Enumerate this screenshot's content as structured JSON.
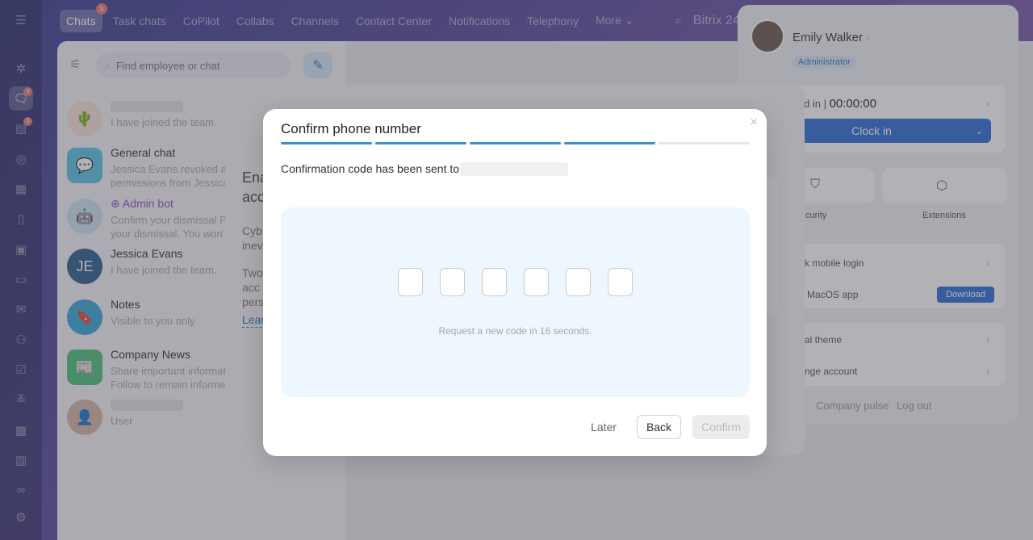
{
  "top_nav": {
    "items": [
      {
        "label": "Chats",
        "badge": "3"
      },
      {
        "label": "Task chats"
      },
      {
        "label": "CoPilot"
      },
      {
        "label": "Collabs"
      },
      {
        "label": "Channels"
      },
      {
        "label": "Contact Center"
      },
      {
        "label": "Notifications"
      },
      {
        "label": "Telephony"
      },
      {
        "label": "More ⌄"
      }
    ],
    "brand": "Bitrix 24"
  },
  "rail": {
    "icons": [
      "menu-icon",
      "copilot-icon",
      "chat-icon",
      "feed-icon",
      "target-icon",
      "calendar-icon",
      "document-icon",
      "tasks-board-icon",
      "drive-icon",
      "mail-icon",
      "contacts-icon",
      "checklist-icon",
      "filter-icon",
      "booking-icon",
      "storage-icon",
      "handshake-icon",
      "settings-icon"
    ],
    "chat_badge": "3",
    "feed_badge": "3"
  },
  "chat_list": {
    "search_placeholder": "Find employee or chat",
    "items": [
      {
        "name": "",
        "message": "I have joined the team.",
        "avatar": "cactus-avatar"
      },
      {
        "name": "General chat",
        "message": "Jessica Evans revoked ac",
        "message2": "permissions from Jessica",
        "avatar": "chat-avatar"
      },
      {
        "name": "Admin bot",
        "message": "Confirm your dismissal P",
        "message2": "your dismissal. You won't",
        "avatar": "bot-avatar"
      },
      {
        "name": "Jessica Evans",
        "message": "I have joined the team.",
        "initials": "JE"
      },
      {
        "name": "Notes",
        "message": "Visible to you only",
        "avatar": "bookmark-avatar"
      },
      {
        "name": "Company News",
        "message": "Share important informat",
        "message2": "Follow to remain informe",
        "avatar": "news-avatar"
      },
      {
        "name": "",
        "message": "User",
        "avatar": "user-photo-avatar"
      }
    ]
  },
  "profile": {
    "name": "Emily Walker",
    "role": "Administrator",
    "clocked_label": "d in |",
    "timer": "00:00:00",
    "clock_in": "Clock in",
    "security": "curity",
    "extensions": "Extensions",
    "mobile_login": "k mobile login",
    "macos_app": "MacOS app",
    "download": "Download",
    "theme": "al theme",
    "change_account": "nge account",
    "company_pulse": "Company pulse",
    "log_out": "Log out"
  },
  "back_modal": {
    "heading": "Ena\nacc",
    "para1": "Cyb\ninev",
    "para2": "Two\nacc\npers",
    "link": "Lear"
  },
  "dialog": {
    "title": "Confirm phone number",
    "steps_total": 5,
    "steps_done": 4,
    "sent_text": "Confirmation code has been sent to",
    "code_digits": [
      "",
      "",
      "",
      "",
      "",
      ""
    ],
    "resend_text": "Request a new code in 16 seconds.",
    "later": "Later",
    "back": "Back",
    "confirm": "Confirm",
    "close_symbol": "×"
  }
}
